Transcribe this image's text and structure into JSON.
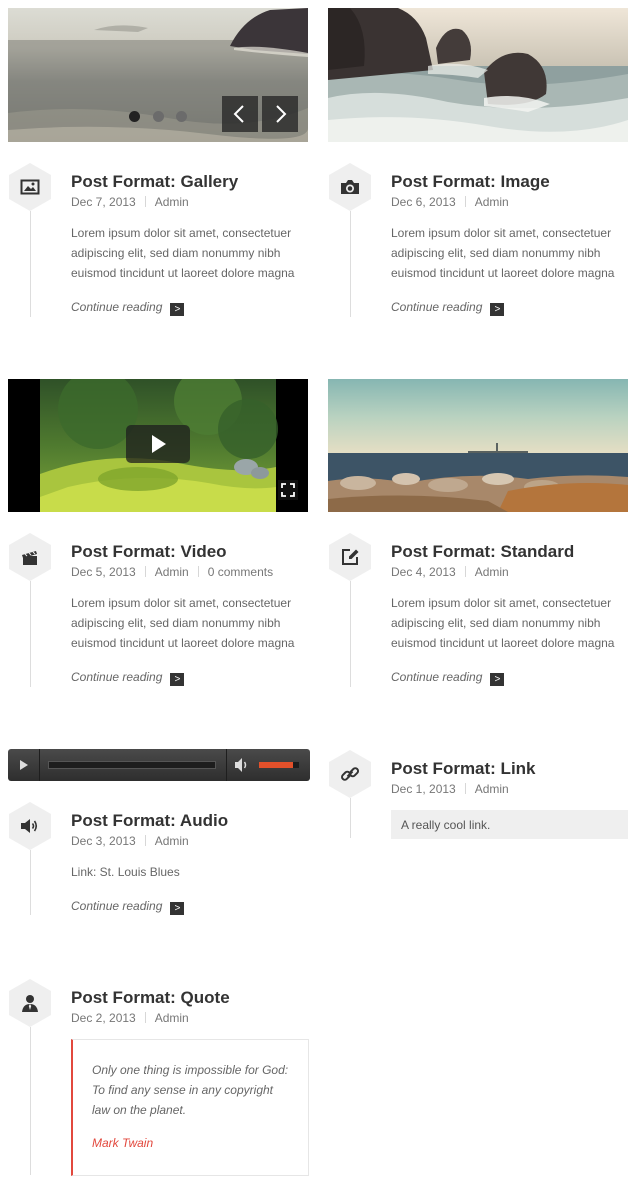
{
  "colors": {
    "accent": "#e2483d",
    "audio_progress": "#e2502a",
    "hex_fill": "#efefef",
    "line": "#dddddd"
  },
  "gallery_post": {
    "title": "Post Format: Gallery",
    "date": "Dec 7, 2013",
    "author": "Admin",
    "excerpt": [
      "Lorem ipsum dolor sit amet, consectetuer",
      "adipiscing elit, sed diam nonummy nibh",
      "euismod tincidunt ut laoreet dolore magna"
    ],
    "continue_label": "Continue reading",
    "icon": "image-icon",
    "slider": {
      "slide_count": 3,
      "active_slide": 1,
      "prev_icon": "chevron-left-icon",
      "next_icon": "chevron-right-icon"
    }
  },
  "image_post": {
    "title": "Post Format: Image",
    "date": "Dec 6, 2013",
    "author": "Admin",
    "excerpt": [
      "Lorem ipsum dolor sit amet, consectetuer",
      "adipiscing elit, sed diam nonummy nibh",
      "euismod tincidunt ut laoreet dolore magna"
    ],
    "continue_label": "Continue reading",
    "icon": "camera-icon"
  },
  "video_post": {
    "title": "Post Format: Video",
    "date": "Dec 5, 2013",
    "author": "Admin",
    "comments": "0 comments",
    "excerpt": [
      "Lorem ipsum dolor sit amet, consectetuer",
      "adipiscing elit, sed diam nonummy nibh",
      "euismod tincidunt ut laoreet dolore magna"
    ],
    "continue_label": "Continue reading",
    "icon": "clapperboard-icon"
  },
  "standard_post": {
    "title": "Post Format: Standard",
    "date": "Dec 4, 2013",
    "author": "Admin",
    "excerpt": [
      "Lorem ipsum dolor sit amet, consectetuer",
      "adipiscing elit, sed diam nonummy nibh",
      "euismod tincidunt ut laoreet dolore magna"
    ],
    "continue_label": "Continue reading",
    "icon": "edit-icon"
  },
  "audio_post": {
    "title": "Post Format: Audio",
    "date": "Dec 3, 2013",
    "author": "Admin",
    "body": "Link: St. Louis Blues",
    "continue_label": "Continue reading",
    "icon": "speaker-icon",
    "player": {
      "play_icon": "play-icon",
      "volume_icon": "volume-icon",
      "progress": 0.0,
      "volume": 0.85
    }
  },
  "link_post": {
    "title": "Post Format: Link",
    "date": "Dec 1, 2013",
    "author": "Admin",
    "link_text": "A really cool link.",
    "icon": "link-icon"
  },
  "quote_post": {
    "title": "Post Format: Quote",
    "date": "Dec 2, 2013",
    "author": "Admin",
    "quote_lines": [
      "Only one thing is impossible for God:",
      "To find any sense in any copyright",
      "law on the planet."
    ],
    "quote_author": "Mark Twain",
    "icon": "user-icon"
  }
}
